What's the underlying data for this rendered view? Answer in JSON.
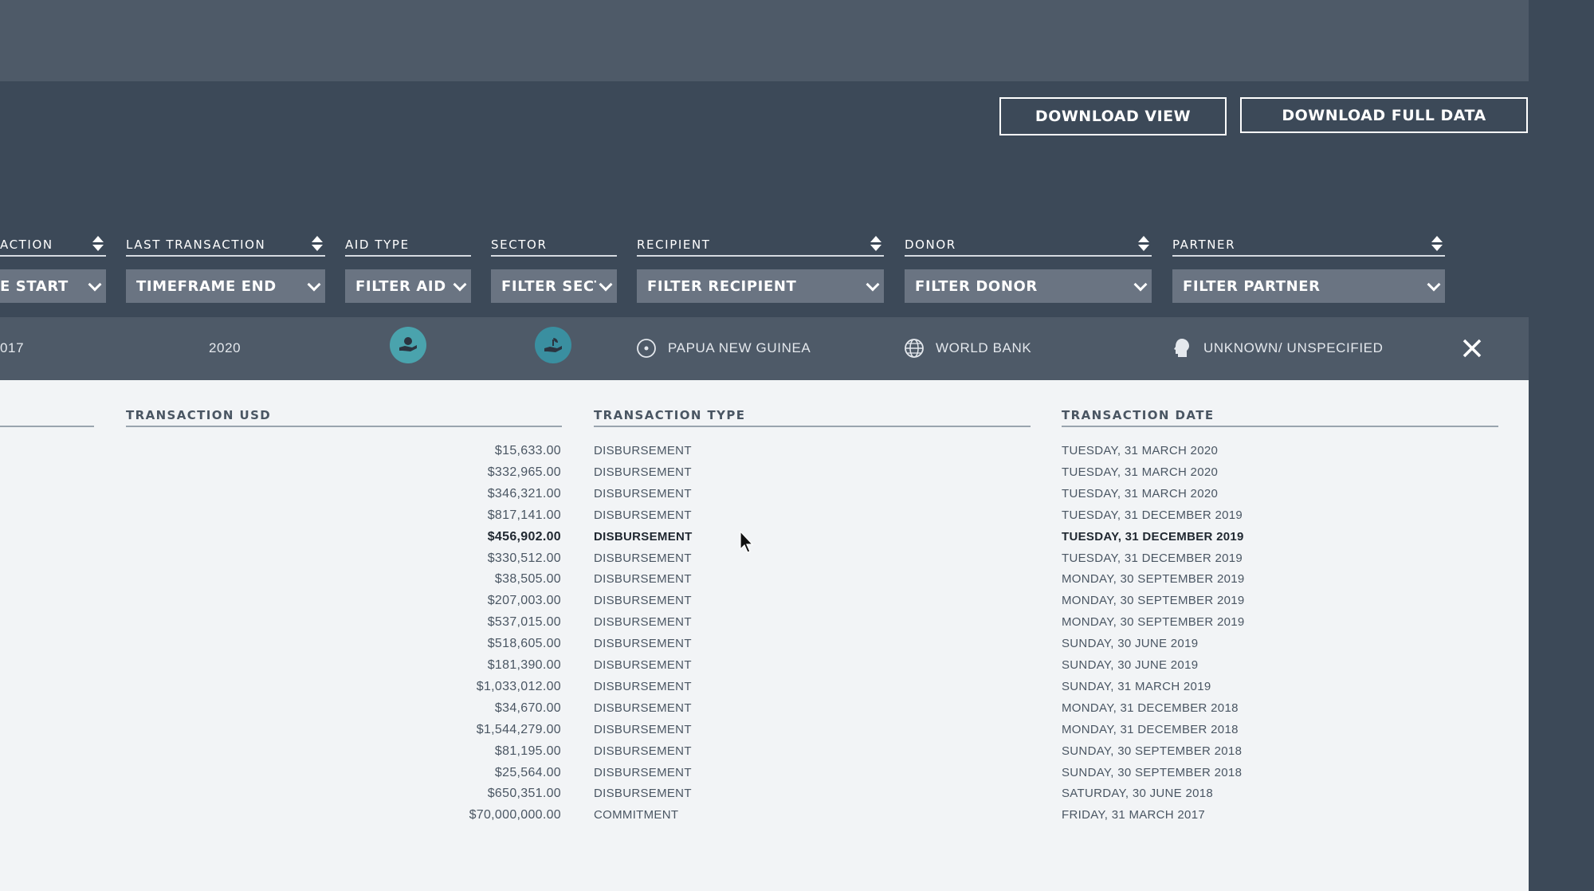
{
  "buttons": {
    "download_view": "DOWNLOAD VIEW",
    "download_full": "DOWNLOAD FULL DATA"
  },
  "columns": {
    "first_transaction": "ACTION",
    "last_transaction": "LAST TRANSACTION",
    "aid_type": "AID TYPE",
    "sector": "SECTOR",
    "recipient": "RECIPIENT",
    "donor": "DONOR",
    "partner": "PARTNER"
  },
  "filters": {
    "timeframe_start": "E START",
    "timeframe_end": "TIMEFRAME END",
    "aid_type": "FILTER AID T",
    "sector": "FILTER SECT",
    "recipient": "FILTER RECIPIENT",
    "donor": "FILTER DONOR",
    "partner": "FILTER PARTNER"
  },
  "active": {
    "first_year": "017",
    "last_year": "2020",
    "recipient": "PAPUA NEW GUINEA",
    "donor": "WORLD BANK",
    "partner": "UNKNOWN/ UNSPECIFIED"
  },
  "colors": {
    "dark_bg": "#3c4958",
    "band_bg": "#4e5a68",
    "select_bg": "#6a7482",
    "badge_teal": "#4aa3ad",
    "table_bg": "#f2f4f6"
  },
  "table": {
    "headers": {
      "usd": "TRANSACTION USD",
      "type": "TRANSACTION TYPE",
      "date": "TRANSACTION DATE"
    },
    "highlighted_row": 4,
    "rows": [
      {
        "usd": "$15,633.00",
        "type": "DISBURSEMENT",
        "date": "TUESDAY, 31 MARCH 2020"
      },
      {
        "usd": "$332,965.00",
        "type": "DISBURSEMENT",
        "date": "TUESDAY, 31 MARCH 2020"
      },
      {
        "usd": "$346,321.00",
        "type": "DISBURSEMENT",
        "date": "TUESDAY, 31 MARCH 2020"
      },
      {
        "usd": "$817,141.00",
        "type": "DISBURSEMENT",
        "date": "TUESDAY, 31 DECEMBER 2019"
      },
      {
        "usd": "$456,902.00",
        "type": "DISBURSEMENT",
        "date": "TUESDAY, 31 DECEMBER 2019"
      },
      {
        "usd": "$330,512.00",
        "type": "DISBURSEMENT",
        "date": "TUESDAY, 31 DECEMBER 2019"
      },
      {
        "usd": "$38,505.00",
        "type": "DISBURSEMENT",
        "date": "MONDAY, 30 SEPTEMBER 2019"
      },
      {
        "usd": "$207,003.00",
        "type": "DISBURSEMENT",
        "date": "MONDAY, 30 SEPTEMBER 2019"
      },
      {
        "usd": "$537,015.00",
        "type": "DISBURSEMENT",
        "date": "MONDAY, 30 SEPTEMBER 2019"
      },
      {
        "usd": "$518,605.00",
        "type": "DISBURSEMENT",
        "date": "SUNDAY, 30 JUNE 2019"
      },
      {
        "usd": "$181,390.00",
        "type": "DISBURSEMENT",
        "date": "SUNDAY, 30 JUNE 2019"
      },
      {
        "usd": "$1,033,012.00",
        "type": "DISBURSEMENT",
        "date": "SUNDAY, 31 MARCH 2019"
      },
      {
        "usd": "$34,670.00",
        "type": "DISBURSEMENT",
        "date": "MONDAY, 31 DECEMBER 2018"
      },
      {
        "usd": "$1,544,279.00",
        "type": "DISBURSEMENT",
        "date": "MONDAY, 31 DECEMBER 2018"
      },
      {
        "usd": "$81,195.00",
        "type": "DISBURSEMENT",
        "date": "SUNDAY, 30 SEPTEMBER 2018"
      },
      {
        "usd": "$25,564.00",
        "type": "DISBURSEMENT",
        "date": "SUNDAY, 30 SEPTEMBER 2018"
      },
      {
        "usd": "$650,351.00",
        "type": "DISBURSEMENT",
        "date": "SATURDAY, 30 JUNE 2018"
      },
      {
        "usd": "$70,000,000.00",
        "type": "COMMITMENT",
        "date": "FRIDAY, 31 MARCH 2017"
      }
    ]
  }
}
